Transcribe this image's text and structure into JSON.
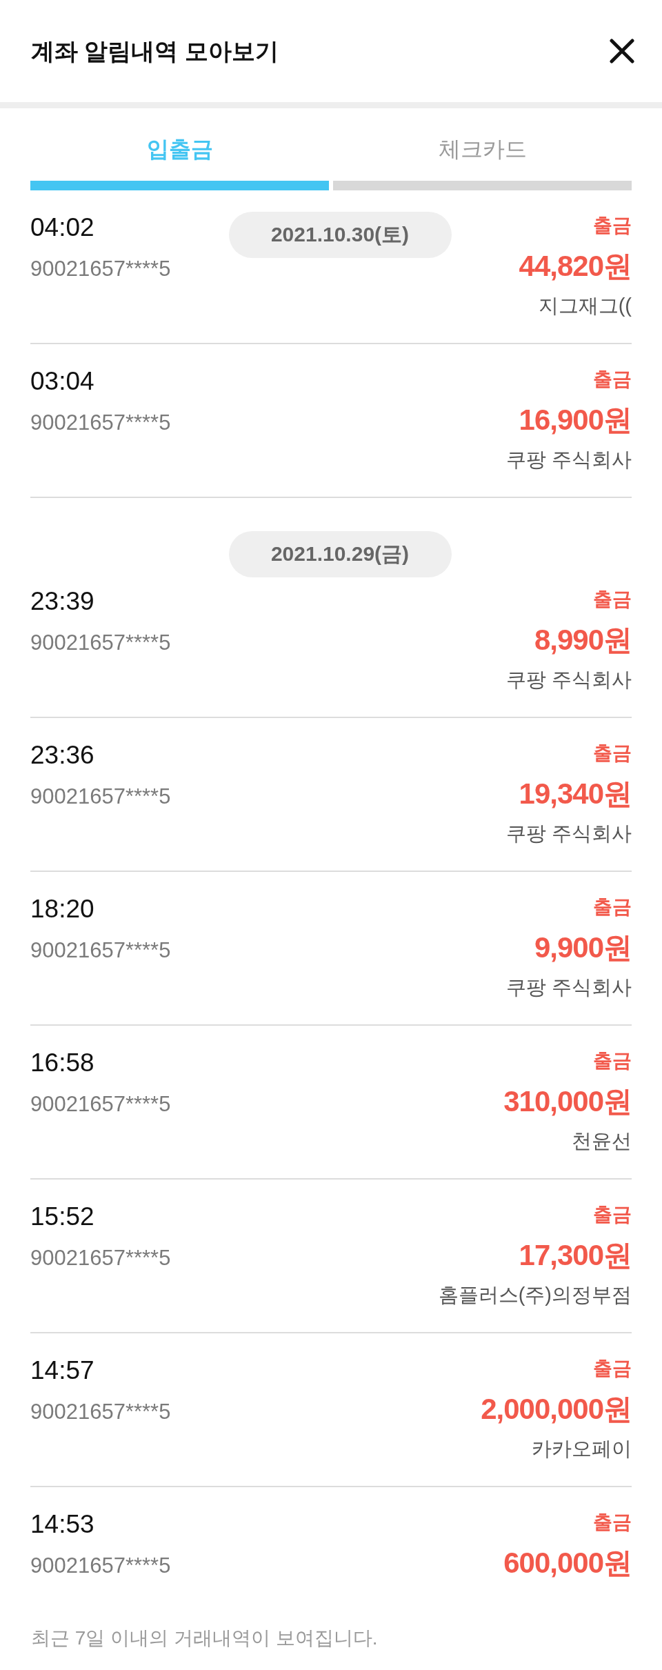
{
  "header": {
    "title": "계좌 알림내역 모아보기"
  },
  "tabs": [
    {
      "label": "입출금",
      "selected": true
    },
    {
      "label": "체크카드",
      "selected": false
    }
  ],
  "groups": [
    {
      "date": "2021.10.30(토)",
      "pinned": true,
      "transactions": [
        {
          "time": "04:02",
          "account": "90021657****5",
          "kind": "withdrawal",
          "type": "출금",
          "amount": "44,820원",
          "merchant": "지그재그(("
        },
        {
          "time": "03:04",
          "account": "90021657****5",
          "kind": "withdrawal",
          "type": "출금",
          "amount": "16,900원",
          "merchant": "쿠팡 주식회사"
        }
      ]
    },
    {
      "date": "2021.10.29(금)",
      "pinned": false,
      "transactions": [
        {
          "time": "23:39",
          "account": "90021657****5",
          "kind": "withdrawal",
          "type": "출금",
          "amount": "8,990원",
          "merchant": "쿠팡 주식회사"
        },
        {
          "time": "23:36",
          "account": "90021657****5",
          "kind": "withdrawal",
          "type": "출금",
          "amount": "19,340원",
          "merchant": "쿠팡 주식회사"
        },
        {
          "time": "18:20",
          "account": "90021657****5",
          "kind": "withdrawal",
          "type": "출금",
          "amount": "9,900원",
          "merchant": "쿠팡 주식회사"
        },
        {
          "time": "16:58",
          "account": "90021657****5",
          "kind": "withdrawal",
          "type": "출금",
          "amount": "310,000원",
          "merchant": "천윤선"
        },
        {
          "time": "15:52",
          "account": "90021657****5",
          "kind": "withdrawal",
          "type": "출금",
          "amount": "17,300원",
          "merchant": "홈플러스(주)의정부점"
        },
        {
          "time": "14:57",
          "account": "90021657****5",
          "kind": "withdrawal",
          "type": "출금",
          "amount": "2,000,000원",
          "merchant": "카카오페이"
        },
        {
          "time": "14:53",
          "account": "90021657****5",
          "kind": "withdrawal",
          "type": "출금",
          "amount": "600,000원"
        }
      ]
    }
  ],
  "footer": {
    "note": "최근 7일 이내의 거래내역이 보여집니다."
  }
}
